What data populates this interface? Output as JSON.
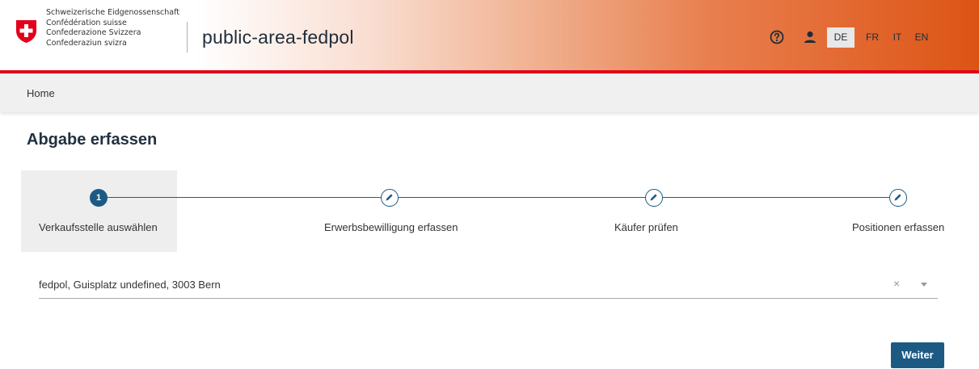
{
  "header": {
    "confederation_lines": [
      "Schweizerische Eidgenossenschaft",
      "Confédération suisse",
      "Confederazione Svizzera",
      "Confederaziun svizra"
    ],
    "app_title": "public-area-fedpol",
    "languages": [
      {
        "code": "DE",
        "active": true
      },
      {
        "code": "FR",
        "active": false
      },
      {
        "code": "IT",
        "active": false
      },
      {
        "code": "EN",
        "active": false
      }
    ]
  },
  "breadcrumb": {
    "home": "Home"
  },
  "page": {
    "title": "Abgabe erfassen"
  },
  "stepper": {
    "steps": [
      {
        "number": "1",
        "label": "Verkaufsstelle auswählen",
        "state": "active"
      },
      {
        "label": "Erwerbsbewilligung erfassen",
        "state": "edit"
      },
      {
        "label": "Käufer prüfen",
        "state": "edit"
      },
      {
        "label": "Positionen erfassen",
        "state": "edit"
      }
    ]
  },
  "select": {
    "value": "fedpol, Guisplatz undefined, 3003 Bern",
    "clear_symbol": "×"
  },
  "actions": {
    "next_label": "Weiter"
  },
  "colors": {
    "primary": "#1c5a84",
    "accent_red": "#e2001a",
    "header_gradient_end": "#dc5414"
  }
}
